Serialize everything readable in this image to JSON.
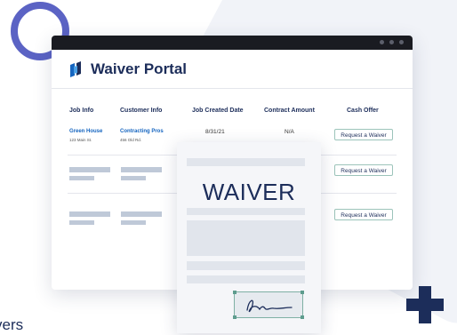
{
  "app": {
    "title": "Waiver Portal"
  },
  "table": {
    "headers": [
      "Job Info",
      "Customer Info",
      "Job Created Date",
      "Contract Amount",
      "Cash Offer"
    ],
    "row1": {
      "job_name": "Green House",
      "job_address": "123 Main St.",
      "customer_name": "Contracting Pros",
      "customer_address": "456 Old Rd.",
      "created_date": "8/31/21",
      "contract_amount": "N/A"
    },
    "action_label": "Request a Waiver"
  },
  "document": {
    "title": "WAIVER"
  },
  "footer_fragment": "vers",
  "colors": {
    "brand_navy": "#1c2d5a",
    "ring_purple": "#5b63c4",
    "link_blue": "#1565c0",
    "button_border": "#9cc4ba"
  }
}
